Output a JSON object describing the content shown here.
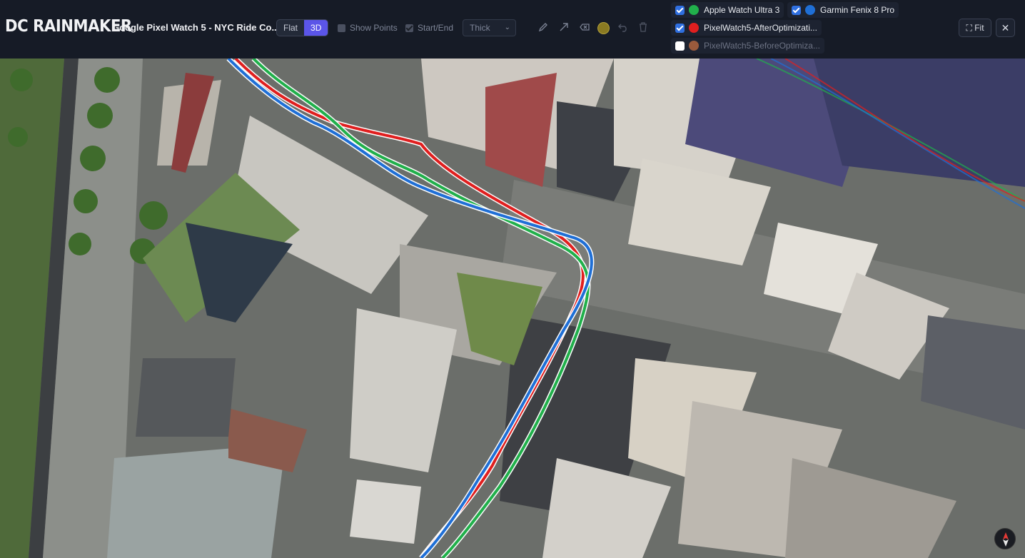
{
  "app": {
    "logo": "DC RAINMAKER",
    "title": "Google Pixel Watch 5 - NYC Ride Co..."
  },
  "view_toggle": {
    "flat": "Flat",
    "threeD": "3D",
    "active": "3D"
  },
  "options": {
    "show_points": {
      "label": "Show Points",
      "checked": false
    },
    "start_end": {
      "label": "Start/End",
      "checked": true
    },
    "line_style": "Thick"
  },
  "tools": {
    "pencil": "pencil-icon",
    "arrow": "arrow-icon",
    "eraser": "eraser-icon",
    "color": "#8a7a22",
    "undo": "undo-icon",
    "trash": "trash-icon"
  },
  "legend": [
    {
      "label": "Apple Watch Ultra 3",
      "color": "#21b04b",
      "checked": true
    },
    {
      "label": "Garmin Fenix 8 Pro",
      "color": "#1f6fd6",
      "checked": true
    },
    {
      "label": "PixelWatch5-AfterOptimizati...",
      "color": "#e01f1f",
      "checked": true
    },
    {
      "label": "PixelWatch5-BeforeOptimiza...",
      "color": "#9a5a3c",
      "checked": false
    }
  ],
  "buttons": {
    "fit": "Fit",
    "close": "close-icon"
  },
  "map": {
    "view": "3D satellite",
    "compass": "compass-icon"
  }
}
